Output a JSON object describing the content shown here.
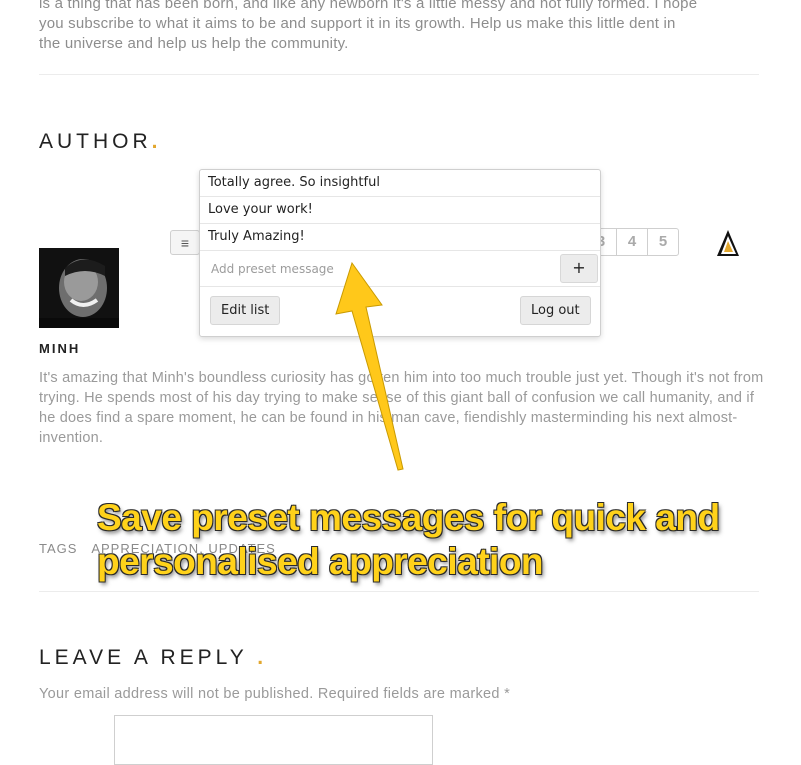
{
  "article": {
    "intro_lines": [
      "is a thing that has been born, and like any newborn it's a little messy and not fully formed. I hope",
      "you subscribe to what it aims to be and support it in its growth. Help us make this little dent in",
      "the universe and help us help the community."
    ]
  },
  "author": {
    "heading": "AUTHOR",
    "heading_dot": ".",
    "name": "MINH",
    "bio": "It's amazing that Minh's boundless curiosity has gotten him into too much trouble just yet. Though it's not from trying. He spends most of his day trying to make sense of this giant ball of confusion we call humanity, and if he does find a spare moment, he can be found in his man cave, fiendishly masterminding his next almost-invention."
  },
  "extension": {
    "menu_icon": "menu-icon",
    "menu_glyph": "≡",
    "logo_icon": "appreciation-logo-icon",
    "rating_options": [
      "3",
      "4",
      "5"
    ],
    "presets": [
      "Totally agree. So insightful",
      "Love your work!",
      "Truly Amazing!"
    ],
    "new_preset_placeholder": "Add preset message",
    "add_label": "+",
    "edit_list_label": "Edit list",
    "logout_label": "Log out"
  },
  "tags": {
    "label": "TAGS",
    "items": [
      "APPRECIATION",
      "UPDATES"
    ],
    "separator": ", "
  },
  "reply": {
    "heading": "LEAVE A REPLY",
    "heading_dot": ".",
    "notice": "Your email address will not be published. Required fields are marked *"
  },
  "callout": {
    "line1": "Save preset messages for quick and",
    "line2": "personalised appreciation"
  },
  "colors": {
    "accent": "#e2a72e",
    "callout_text": "#ffd21a",
    "arrow_fill": "#ffc81a"
  }
}
